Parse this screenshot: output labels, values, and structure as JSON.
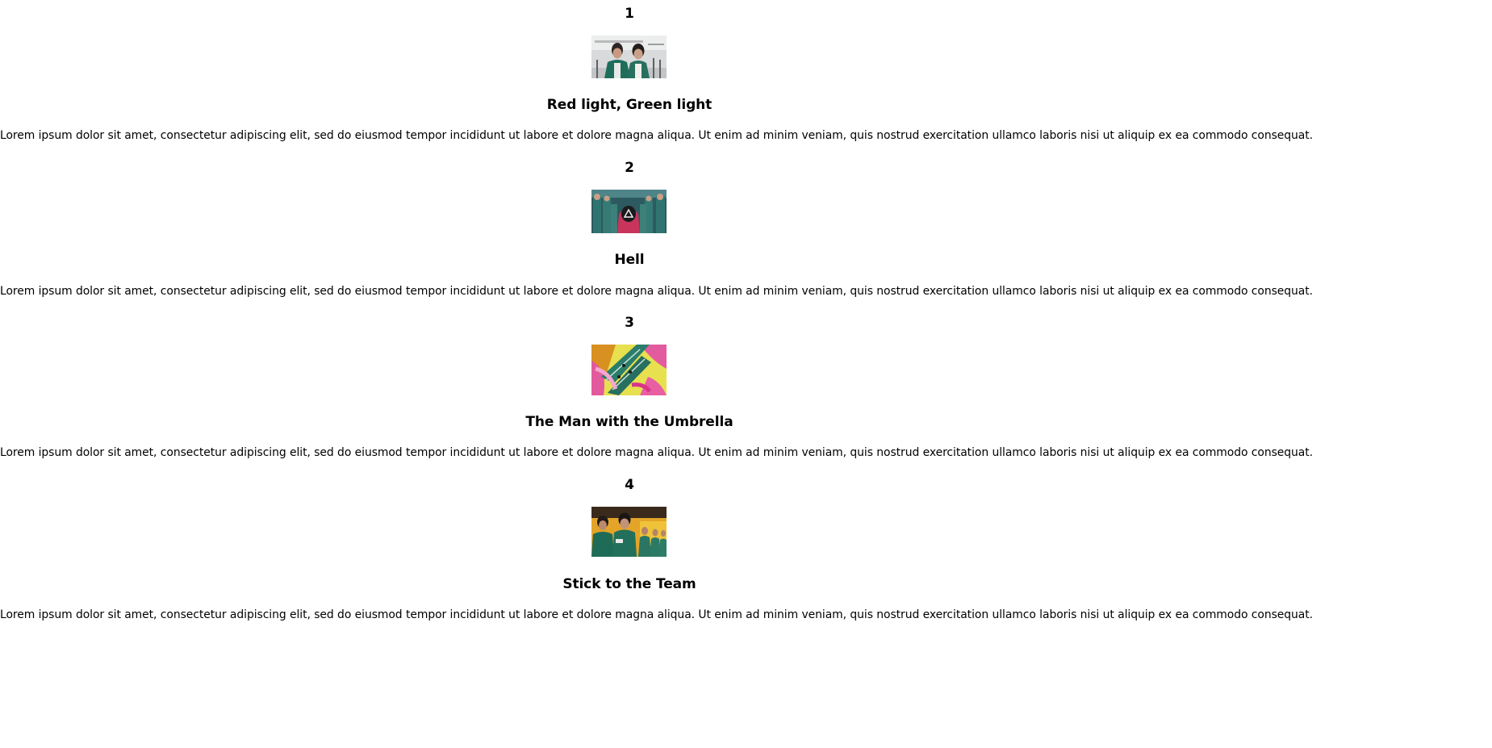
{
  "episodes": [
    {
      "number": "1",
      "title": "Red light, Green light",
      "description": "Lorem ipsum dolor sit amet, consectetur adipiscing elit, sed do eiusmod tempor incididunt ut labore et dolore magna aliqua. Ut enim ad minim veniam, quis nostrud exercitation ullamco laboris nisi ut aliquip ex ea commodo consequat."
    },
    {
      "number": "2",
      "title": "Hell",
      "description": "Lorem ipsum dolor sit amet, consectetur adipiscing elit, sed do eiusmod tempor incididunt ut labore et dolore magna aliqua. Ut enim ad minim veniam, quis nostrud exercitation ullamco laboris nisi ut aliquip ex ea commodo consequat."
    },
    {
      "number": "3",
      "title": "The Man with the Umbrella",
      "description": "Lorem ipsum dolor sit amet, consectetur adipiscing elit, sed do eiusmod tempor incididunt ut labore et dolore magna aliqua. Ut enim ad minim veniam, quis nostrud exercitation ullamco laboris nisi ut aliquip ex ea commodo consequat."
    },
    {
      "number": "4",
      "title": "Stick to the Team",
      "description": "Lorem ipsum dolor sit amet, consectetur adipiscing elit, sed do eiusmod tempor incididunt ut labore et dolore magna aliqua. Ut enim ad minim veniam, quis nostrud exercitation ullamco laboris nisi ut aliquip ex ea commodo consequat."
    }
  ]
}
